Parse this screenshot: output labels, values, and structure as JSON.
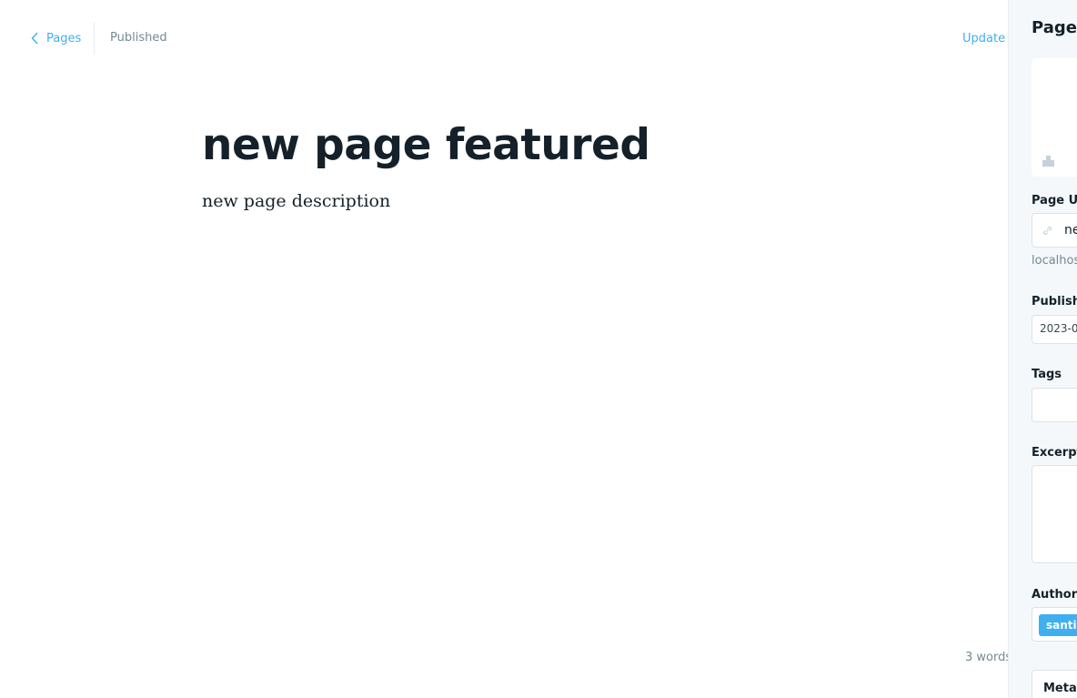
{
  "header": {
    "back_label": "Pages",
    "status": "Published",
    "update_label": "Update"
  },
  "editor": {
    "title": "new page featured",
    "body": "new page description",
    "word_count": "3 words"
  },
  "settings": {
    "title": "Page s",
    "url_label": "Page UR",
    "url_value": "ne",
    "url_hint": "localhost",
    "publish_label": "Publish d",
    "publish_date": "2023-0",
    "tags_label": "Tags",
    "excerpt_label": "Excerpt",
    "authors_label": "Authors",
    "author_tag": "santia",
    "meta_label": "Meta d"
  },
  "colors": {
    "accent": "#3eb0ef",
    "muted": "#738a94",
    "panel_bg": "#f4f8fb"
  },
  "icons": {
    "back": "chevron-left-icon",
    "update": "chevron-down-icon",
    "image": "image-placeholder-icon",
    "url": "link-icon"
  }
}
